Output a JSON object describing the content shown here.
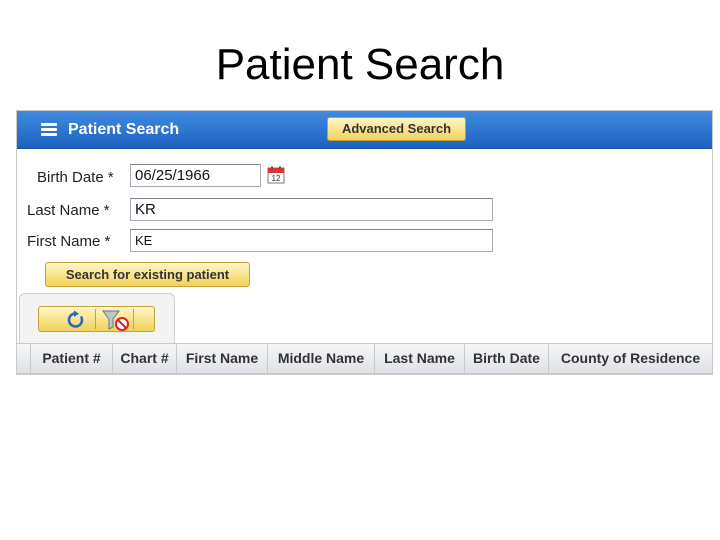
{
  "slide": {
    "title": "Patient Search"
  },
  "panel": {
    "title": "Patient Search",
    "advanced_search_label": "Advanced Search"
  },
  "form": {
    "birth_date_label": "Birth Date *",
    "birth_date_value": "06/25/1966",
    "last_name_label": "Last Name *",
    "last_name_value": "KR",
    "first_name_label": "First Name *",
    "first_name_value": "KE",
    "search_button_label": "Search for existing patient"
  },
  "icons": {
    "menu": "menu-icon",
    "calendar": "calendar-icon",
    "refresh": "refresh-icon",
    "clear_filter": "filter-clear-icon"
  },
  "grid": {
    "columns": [
      "Patient #",
      "Chart #",
      "First Name",
      "Middle Name",
      "Last Name",
      "Birth Date",
      "County of Residence"
    ]
  },
  "colors": {
    "header_blue": "#2f76d2",
    "button_yellow": "#f6dc6e"
  }
}
